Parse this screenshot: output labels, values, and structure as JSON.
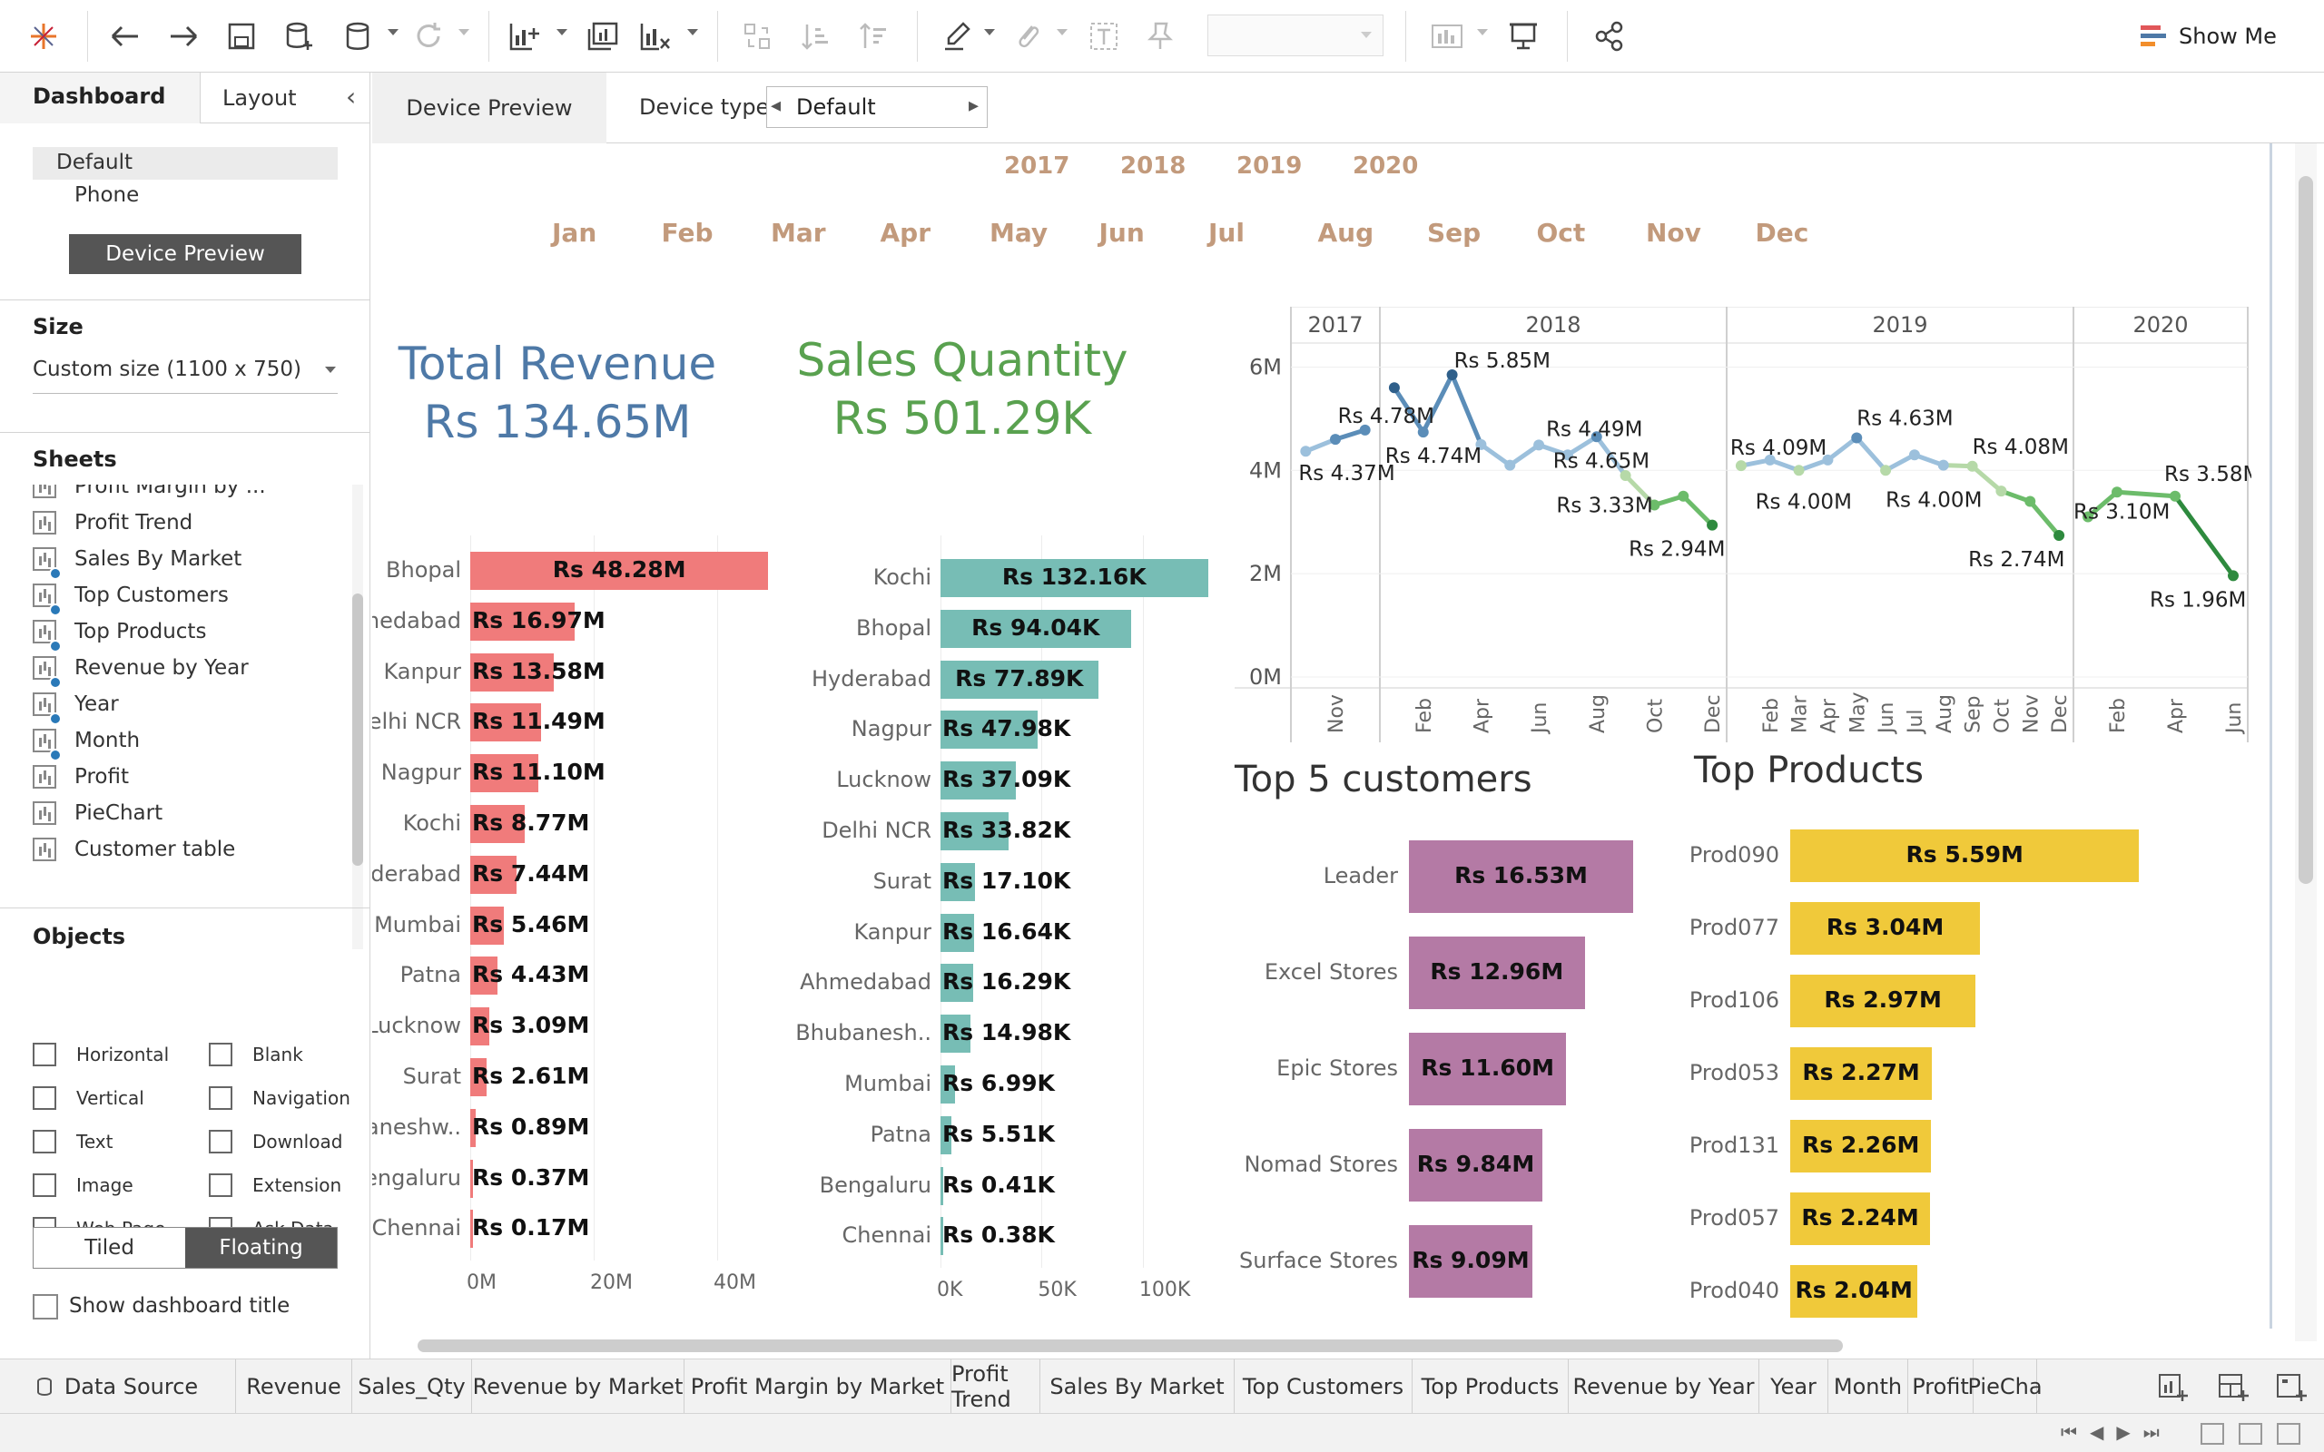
{
  "toolbar": {
    "show_me_label": "Show Me"
  },
  "left_pane": {
    "tabs": {
      "dashboard": "Dashboard",
      "layout": "Layout"
    },
    "device_list": [
      "Default",
      "Phone"
    ],
    "device_preview_button": "Device Preview",
    "size_title": "Size",
    "size_value": "Custom size (1100 x 750)",
    "sheets_title": "Sheets",
    "sheets": [
      {
        "label": "Profit Margin by ...",
        "checked": false
      },
      {
        "label": "Profit Trend",
        "checked": false
      },
      {
        "label": "Sales By Market",
        "checked": true
      },
      {
        "label": "Top Customers",
        "checked": true
      },
      {
        "label": "Top Products",
        "checked": true
      },
      {
        "label": "Revenue by Year",
        "checked": true
      },
      {
        "label": "Year",
        "checked": true
      },
      {
        "label": "Month",
        "checked": true
      },
      {
        "label": "Profit",
        "checked": false
      },
      {
        "label": "PieChart",
        "checked": false
      },
      {
        "label": "Customer table",
        "checked": false
      }
    ],
    "objects_title": "Objects",
    "objects": [
      "Horizontal",
      "Blank",
      "Vertical",
      "Navigation",
      "Text",
      "Download",
      "Image",
      "Extension",
      "Web Page",
      "Ask Data"
    ],
    "tiled_label": "Tiled",
    "floating_label": "Floating",
    "show_title_label": "Show dashboard title"
  },
  "device_bar": {
    "device_preview_tab": "Device Preview",
    "device_type_label": "Device type",
    "device_type_value": "Default"
  },
  "filters": {
    "years": [
      "2017",
      "2018",
      "2019",
      "2020"
    ],
    "months": [
      "Jan",
      "Feb",
      "Mar",
      "Apr",
      "May",
      "Jun",
      "Jul",
      "Aug",
      "Sep",
      "Oct",
      "Nov",
      "Dec"
    ]
  },
  "kpis": {
    "revenue_title": "Total Revenue",
    "revenue_value": "Rs 134.65M",
    "qty_title": "Sales Quantity",
    "qty_value": "Rs 501.29K"
  },
  "titles": {
    "customers": "Top 5 customers",
    "products": "Top Products"
  },
  "bottom_tabs": [
    "Data Source",
    "Revenue",
    "Sales_Qty",
    "Revenue by Market",
    "Profit Margin by Market",
    "Profit Trend",
    "Sales By Market",
    "Top Customers",
    "Top Products",
    "Revenue by Year",
    "Year",
    "Month",
    "Profit",
    "PieCha"
  ],
  "colors": {
    "revenue_bar": "#f07b7b",
    "qty_bar": "#77bdb5",
    "customer_bar": "#b47aa5",
    "product_bar": "#f0c93a",
    "revenue_kpi": "#4e79a7",
    "qty_kpi": "#59a14f",
    "filter_text": "#c29a7c"
  },
  "chart_data": [
    {
      "type": "bar",
      "name": "Revenue by Market",
      "categories": [
        "Bhopal",
        "Ahmedabad",
        "Kanpur",
        "Delhi NCR",
        "Nagpur",
        "Kochi",
        "Hyderabad",
        "Mumbai",
        "Patna",
        "Lucknow",
        "Surat",
        "Bhubaneshwar",
        "Bengaluru",
        "Chennai"
      ],
      "category_labels": [
        "Bhopal",
        "medabad",
        "Kanpur",
        "elhi NCR",
        "Nagpur",
        "Kochi",
        "yderabad",
        "Mumbai",
        "Patna",
        "Lucknow",
        "Surat",
        "aneshw..",
        "engaluru",
        "Chennai"
      ],
      "values": [
        48.28,
        16.97,
        13.58,
        11.49,
        11.1,
        8.77,
        7.44,
        5.46,
        4.43,
        3.09,
        2.61,
        0.89,
        0.37,
        0.17
      ],
      "labels": [
        "Rs 48.28M",
        "Rs 16.97M",
        "Rs 13.58M",
        "Rs 11.49M",
        "Rs 11.10M",
        "Rs 8.77M",
        "Rs 7.44M",
        "Rs 5.46M",
        "Rs 4.43M",
        "Rs 3.09M",
        "Rs 2.61M",
        "Rs 0.89M",
        "Rs 0.37M",
        "Rs 0.17M"
      ],
      "xticks": [
        "0M",
        "20M",
        "40M"
      ],
      "xlim": [
        0,
        50
      ]
    },
    {
      "type": "bar",
      "name": "Sales Quantity by Market",
      "categories": [
        "Kochi",
        "Bhopal",
        "Hyderabad",
        "Nagpur",
        "Lucknow",
        "Delhi NCR",
        "Surat",
        "Kanpur",
        "Ahmedabad",
        "Bhubanesh..",
        "Mumbai",
        "Patna",
        "Bengaluru",
        "Chennai"
      ],
      "values": [
        132.16,
        94.04,
        77.89,
        47.98,
        37.09,
        33.82,
        17.1,
        16.64,
        16.29,
        14.98,
        6.99,
        5.51,
        0.41,
        0.38
      ],
      "labels": [
        "Rs 132.16K",
        "Rs 94.04K",
        "Rs 77.89K",
        "Rs 47.98K",
        "Rs 37.09K",
        "Rs 33.82K",
        "Rs 17.10K",
        "Rs 16.64K",
        "Rs 16.29K",
        "Rs 14.98K",
        "Rs 6.99K",
        "Rs 5.51K",
        "Rs 0.41K",
        "Rs 0.38K"
      ],
      "xticks": [
        "0K",
        "50K",
        "100K"
      ],
      "xlim": [
        0,
        140
      ]
    },
    {
      "type": "line",
      "name": "Revenue trend",
      "year_headers": [
        "2017",
        "2018",
        "2019",
        "2020"
      ],
      "yticks": [
        "6M",
        "4M",
        "2M",
        "0M"
      ],
      "ylim": [
        0,
        6.5
      ],
      "x_labels": [
        "Nov",
        "Feb",
        "Apr",
        "Jun",
        "Aug",
        "Oct",
        "Dec",
        "Feb",
        "Mar",
        "Apr",
        "May",
        "Jun",
        "Jul",
        "Aug",
        "Sep",
        "Oct",
        "Nov",
        "Dec",
        "Feb",
        "Apr",
        "Jun"
      ],
      "points": [
        {
          "year": "2017",
          "month": "Oct",
          "y": 4.37
        },
        {
          "year": "2017",
          "month": "Nov",
          "y": 4.6
        },
        {
          "year": "2017",
          "month": "Dec",
          "y": 4.78
        },
        {
          "year": "2018",
          "month": "Jan",
          "y": 5.6
        },
        {
          "year": "2018",
          "month": "Feb",
          "y": 4.74
        },
        {
          "year": "2018",
          "month": "Mar",
          "y": 5.85
        },
        {
          "year": "2018",
          "month": "Apr",
          "y": 4.5
        },
        {
          "year": "2018",
          "month": "May",
          "y": 4.1
        },
        {
          "year": "2018",
          "month": "Jun",
          "y": 4.49
        },
        {
          "year": "2018",
          "month": "Jul",
          "y": 4.3
        },
        {
          "year": "2018",
          "month": "Aug",
          "y": 4.65
        },
        {
          "year": "2018",
          "month": "Sep",
          "y": 3.9
        },
        {
          "year": "2018",
          "month": "Oct",
          "y": 3.33
        },
        {
          "year": "2018",
          "month": "Nov",
          "y": 3.5
        },
        {
          "year": "2018",
          "month": "Dec",
          "y": 2.94
        },
        {
          "year": "2019",
          "month": "Jan",
          "y": 4.09
        },
        {
          "year": "2019",
          "month": "Feb",
          "y": 4.2
        },
        {
          "year": "2019",
          "month": "Mar",
          "y": 4.0
        },
        {
          "year": "2019",
          "month": "Apr",
          "y": 4.2
        },
        {
          "year": "2019",
          "month": "May",
          "y": 4.63
        },
        {
          "year": "2019",
          "month": "Jun",
          "y": 4.0
        },
        {
          "year": "2019",
          "month": "Jul",
          "y": 4.3
        },
        {
          "year": "2019",
          "month": "Aug",
          "y": 4.1
        },
        {
          "year": "2019",
          "month": "Sep",
          "y": 4.08
        },
        {
          "year": "2019",
          "month": "Oct",
          "y": 3.6
        },
        {
          "year": "2019",
          "month": "Nov",
          "y": 3.4
        },
        {
          "year": "2019",
          "month": "Dec",
          "y": 2.74
        },
        {
          "year": "2020",
          "month": "Jan",
          "y": 3.1
        },
        {
          "year": "2020",
          "month": "Feb",
          "y": 3.58
        },
        {
          "year": "2020",
          "month": "Apr",
          "y": 3.5
        },
        {
          "year": "2020",
          "month": "Jun",
          "y": 1.96
        }
      ],
      "annotations": [
        "Rs 4.78M",
        "Rs 4.37M",
        "Rs 5.85M",
        "Rs 4.74M",
        "Rs 4.49M",
        "Rs 4.65M",
        "Rs 3.33M",
        "Rs 2.94M",
        "Rs 4.09M",
        "Rs 4.00M",
        "Rs 4.63M",
        "Rs 4.00M",
        "Rs 4.08M",
        "Rs 2.74M",
        "Rs 3.10M",
        "Rs 3.58M",
        "Rs 1.96M"
      ]
    },
    {
      "type": "bar",
      "name": "Top 5 customers",
      "categories": [
        "Leader",
        "Excel Stores",
        "Epic Stores",
        "Nomad Stores",
        "Surface Stores"
      ],
      "values": [
        16.53,
        12.96,
        11.6,
        9.84,
        9.09
      ],
      "labels": [
        "Rs 16.53M",
        "Rs 12.96M",
        "Rs 11.60M",
        "Rs 9.84M",
        "Rs 9.09M"
      ],
      "xlim": [
        0,
        17
      ]
    },
    {
      "type": "bar",
      "name": "Top Products",
      "categories": [
        "Prod090",
        "Prod077",
        "Prod106",
        "Prod053",
        "Prod131",
        "Prod057",
        "Prod040"
      ],
      "values": [
        5.59,
        3.04,
        2.97,
        2.27,
        2.26,
        2.24,
        2.04
      ],
      "labels": [
        "Rs 5.59M",
        "Rs 3.04M",
        "Rs 2.97M",
        "Rs 2.27M",
        "Rs 2.26M",
        "Rs 2.24M",
        "Rs 2.04M"
      ],
      "xlim": [
        0,
        5.7
      ]
    }
  ]
}
